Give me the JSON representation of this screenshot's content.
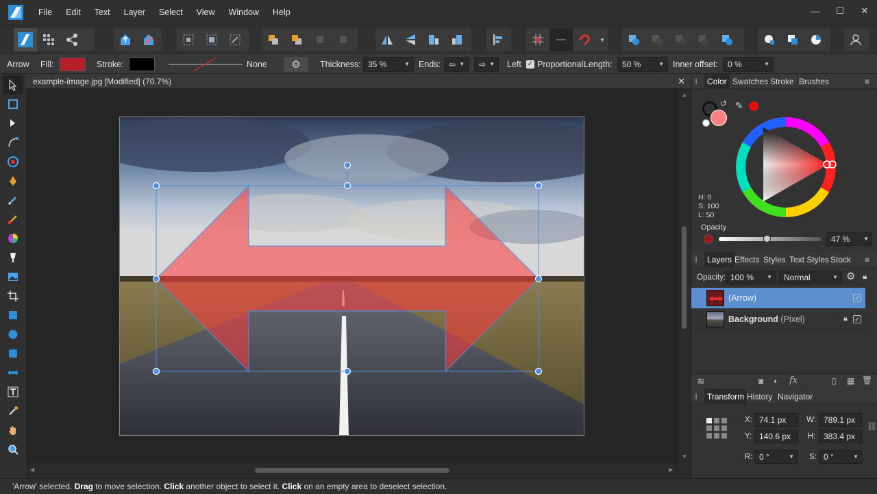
{
  "menu": [
    "File",
    "Edit",
    "Text",
    "Layer",
    "Select",
    "View",
    "Window",
    "Help"
  ],
  "window_controls": {
    "minimize": "—",
    "maximize": "☐",
    "close": "✕"
  },
  "context": {
    "tool_name": "Arrow",
    "fill_label": "Fill:",
    "fill_color": "#b5202a",
    "stroke_label": "Stroke:",
    "stroke_color": "#000000",
    "stroke_style": "None",
    "thickness_label": "Thickness:",
    "thickness_value": "35 %",
    "ends_label": "Ends:",
    "left_label": "Left",
    "proportional_label": "Proportional",
    "length_label": "Length:",
    "length_value": "50 %",
    "inner_offset_label": "Inner offset:",
    "inner_offset_value": "0 %"
  },
  "document": {
    "title": "example-image.jpg [Modified] (70.7%)",
    "close": "✕"
  },
  "color_panel": {
    "tabs": [
      "Color",
      "Swatches",
      "Stroke",
      "Brushes"
    ],
    "active_tab": "Color",
    "h": "H: 0",
    "s": "S: 100",
    "l": "L: 50",
    "opacity_label": "Opacity",
    "opacity_value": "47 %",
    "primary_color": "#ff8080",
    "accent": "#e03030"
  },
  "layers_panel": {
    "tabs": [
      "Layers",
      "Effects",
      "Styles",
      "Text Styles",
      "Stock"
    ],
    "active_tab": "Layers",
    "opacity_label": "Opacity:",
    "opacity_value": "100 %",
    "blend_mode": "Normal",
    "layers": [
      {
        "name": "(Arrow)",
        "bold_part": "",
        "suffix": "(Arrow)",
        "selected": true
      },
      {
        "name": "Background",
        "bold_part": "Background",
        "suffix": " (Pixel)",
        "selected": false
      }
    ]
  },
  "transform_panel": {
    "tabs": [
      "Transform",
      "History",
      "Navigator"
    ],
    "active_tab": "Transform",
    "x_label": "X:",
    "x_value": "74.1 px",
    "y_label": "Y:",
    "y_value": "140.6 px",
    "w_label": "W:",
    "w_value": "789.1 px",
    "h_label": "H:",
    "h_value": "383.4 px",
    "r_label": "R:",
    "r_value": "0 °",
    "s_label": "S:",
    "s_value": "0 °"
  },
  "status": {
    "part1": "'Arrow' selected. ",
    "b1": "Drag",
    "part2": " to move selection. ",
    "b2": "Click",
    "part3": " another object to select it. ",
    "b3": "Click",
    "part4": " on an empty area to deselect selection."
  }
}
